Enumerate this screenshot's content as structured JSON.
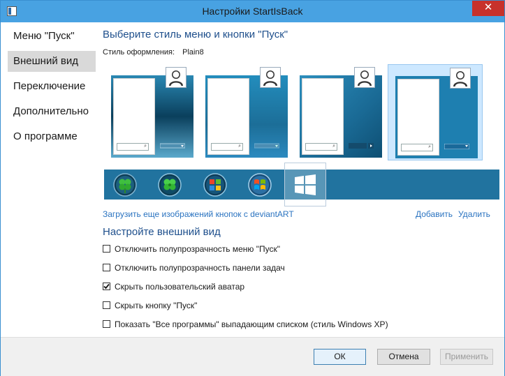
{
  "window": {
    "title": "Настройки StartIsBack",
    "close_symbol": "✕"
  },
  "sidebar": {
    "items": [
      {
        "label": "Меню \"Пуск\""
      },
      {
        "label": "Внешний вид",
        "selected": true
      },
      {
        "label": "Переключение"
      },
      {
        "label": "Дополнительно"
      },
      {
        "label": "О программе"
      }
    ]
  },
  "main": {
    "heading": "Выберите стиль меню и кнопки \"Пуск\"",
    "style_label": "Стиль оформления:",
    "style_value": "Plain8",
    "orb_icons": [
      "clover-orb-icon",
      "green-clover-orb-icon",
      "windows-orb-icon",
      "windows7-orb-icon",
      "windows8-logo-icon"
    ],
    "links": {
      "more_orbs": "Загрузить еще изображений кнопок с deviantART",
      "add": "Добавить",
      "remove": "Удалить"
    },
    "appearance_heading": "Настройте внешний вид",
    "options": [
      {
        "label": "Отключить полупрозрачность меню \"Пуск\"",
        "checked": false
      },
      {
        "label": "Отключить полупрозрачность панели задач",
        "checked": false
      },
      {
        "label": "Скрыть пользовательский аватар",
        "checked": true
      },
      {
        "label": "Скрыть кнопку \"Пуск\"",
        "checked": false
      },
      {
        "label": "Показать \"Все программы\" выпадающим списком (стиль Windows XP)",
        "checked": false
      }
    ]
  },
  "footer": {
    "ok": "ОК",
    "cancel": "Отмена",
    "apply": "Применить"
  },
  "colors": {
    "titlebar": "#48a2e2",
    "close": "#c7312b",
    "accent_text": "#1e4f8c",
    "link": "#2a73c0",
    "strip": "#21739f"
  }
}
